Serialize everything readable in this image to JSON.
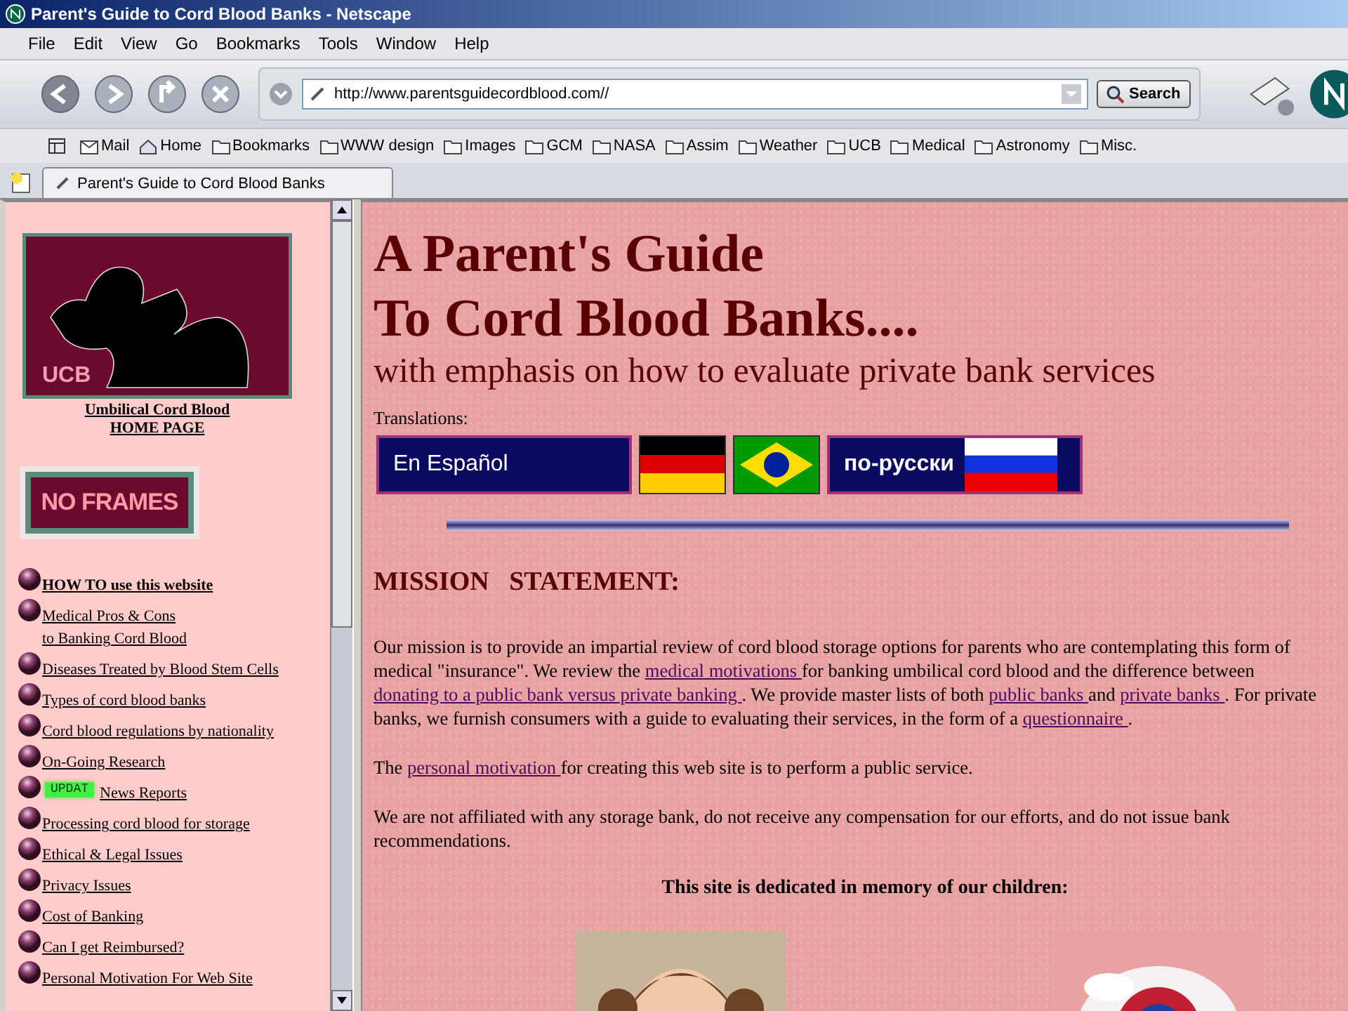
{
  "window": {
    "title": "Parent's Guide to Cord Blood Banks - Netscape"
  },
  "menu": [
    "File",
    "Edit",
    "View",
    "Go",
    "Bookmarks",
    "Tools",
    "Window",
    "Help"
  ],
  "nav": {
    "url": "http://www.parentsguidecordblood.com//",
    "search_button": "Search"
  },
  "personal_toolbar": [
    {
      "kind": "mail",
      "label": "Mail"
    },
    {
      "kind": "home",
      "label": "Home"
    },
    {
      "kind": "folder",
      "label": "Bookmarks"
    },
    {
      "kind": "folder",
      "label": "WWW design"
    },
    {
      "kind": "folder",
      "label": "Images"
    },
    {
      "kind": "folder",
      "label": "GCM"
    },
    {
      "kind": "folder",
      "label": "NASA"
    },
    {
      "kind": "folder",
      "label": "Assim"
    },
    {
      "kind": "folder",
      "label": "Weather"
    },
    {
      "kind": "folder",
      "label": "UCB"
    },
    {
      "kind": "folder",
      "label": "Medical"
    },
    {
      "kind": "folder",
      "label": "Astronomy"
    },
    {
      "kind": "folder",
      "label": "Misc."
    }
  ],
  "tabs": [
    {
      "label": "Parent's Guide to Cord Blood Banks",
      "selected": true
    }
  ],
  "sidebar": {
    "logo_text": "UCB",
    "home_link": [
      "Umbilical Cord Blood",
      "HOME PAGE"
    ],
    "no_frames": "NO FRAMES",
    "links": [
      {
        "label": "HOW TO use this website",
        "bold": true
      },
      {
        "label": "Medical Pros & Cons\nto Banking Cord Blood",
        "bold": false
      },
      {
        "label": "Diseases Treated by Blood Stem Cells",
        "bold": false
      },
      {
        "label": "Types of cord blood banks",
        "bold": false
      },
      {
        "label": "Cord blood regulations by nationality",
        "bold": false
      },
      {
        "label": "On-Going Research",
        "bold": false
      },
      {
        "label": "News Reports",
        "bold": false,
        "badge": "UPDAT"
      },
      {
        "label": "Processing cord blood for storage",
        "bold": false
      },
      {
        "label": "Ethical & Legal Issues",
        "bold": false
      },
      {
        "label": "Privacy Issues",
        "bold": false
      },
      {
        "label": "Cost of Banking",
        "bold": false
      },
      {
        "label": "Can I get Reimbursed?",
        "bold": false
      },
      {
        "label": "Personal Motivation For Web Site",
        "bold": false
      }
    ]
  },
  "main": {
    "title_lines": [
      "A Parent's Guide",
      "To Cord Blood Banks...."
    ],
    "subtitle": "with emphasis on how to evaluate private bank services",
    "translations_label": "Translations:",
    "translations": [
      {
        "kind": "text",
        "label": "En Español"
      },
      {
        "kind": "germany"
      },
      {
        "kind": "brazil"
      },
      {
        "kind": "russia",
        "label": "по-русски"
      }
    ],
    "heading": "MISSION   STATEMENT:",
    "paragraphs": [
      [
        {
          "kind": "text",
          "text": "Our mission is to provide an impartial review of cord blood storage options for parents who are contemplating this form of medical \"insurance\". We review the "
        },
        {
          "kind": "link",
          "text": "medical motivations "
        },
        {
          "kind": "text",
          "text": "for banking umbilical cord blood and the difference between "
        },
        {
          "kind": "link",
          "text": "donating to a public bank versus private banking "
        },
        {
          "kind": "text",
          "text": ". We provide master lists of both "
        },
        {
          "kind": "link",
          "text": "public banks "
        },
        {
          "kind": "text",
          "text": "and "
        },
        {
          "kind": "link",
          "text": "private banks "
        },
        {
          "kind": "text",
          "text": ". For private banks, we furnish consumers with a guide to evaluating their services, in the form of a "
        },
        {
          "kind": "link",
          "text": "questionnaire "
        },
        {
          "kind": "text",
          "text": "."
        }
      ],
      [
        {
          "kind": "text",
          "text": "The "
        },
        {
          "kind": "link",
          "text": "personal motivation "
        },
        {
          "kind": "text",
          "text": "for creating this web site is to perform a public service."
        }
      ],
      [
        {
          "kind": "text",
          "text": "We are not affiliated with any storage bank, do not receive any compensation for our efforts, and do not issue bank recommendations."
        }
      ]
    ],
    "dedication": "This site is dedicated in memory of our children:",
    "photos": [
      {
        "kind": "picture"
      },
      {
        "kind": "picture"
      }
    ]
  }
}
